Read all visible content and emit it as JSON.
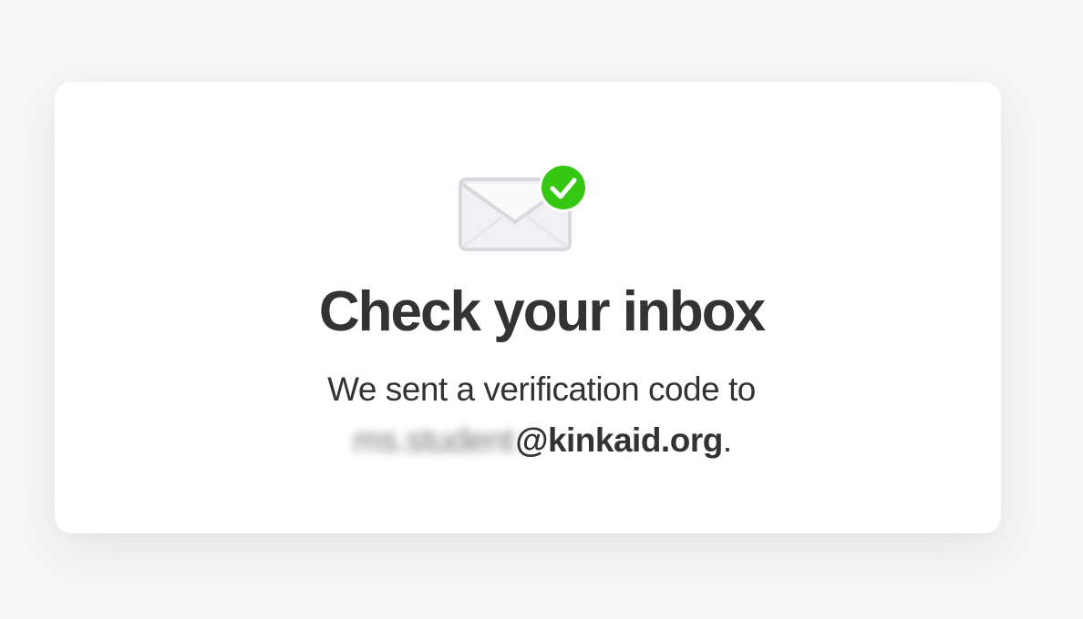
{
  "dialog": {
    "title": "Check your inbox",
    "message_line1": "We sent a verification code to",
    "email_local_part": "ms.student",
    "email_domain": "@kinkaid.org",
    "email_trailing_punctuation": "."
  },
  "icons": {
    "envelope": "envelope-icon",
    "check_badge": "checkmark-circle-icon"
  },
  "colors": {
    "background": "#f7f7f7",
    "card": "#ffffff",
    "text": "#333333",
    "success": "#36c713",
    "envelope": "#d9d9dd"
  }
}
